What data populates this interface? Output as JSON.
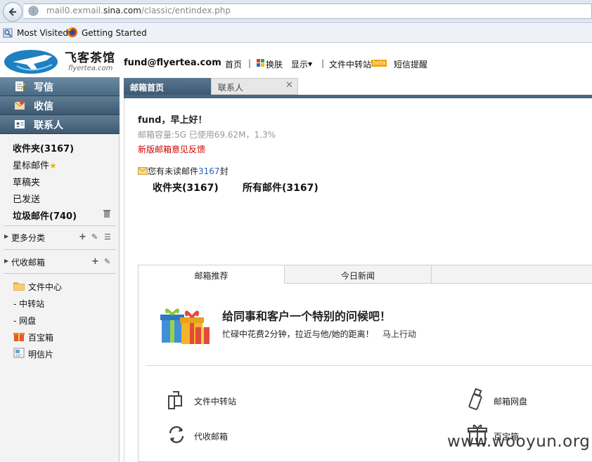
{
  "browser": {
    "url_prefix": "mail0.exmail.",
    "url_domain": "sina.com",
    "url_path": "/classic/entindex.php",
    "bookmarks": [
      "Most Visited",
      "Getting Started"
    ]
  },
  "header": {
    "logo_text": "飞客茶馆",
    "logo_sub": "flyertea.com",
    "account": "fund@flyertea.com",
    "nav": [
      "首页",
      "换肤",
      "显示",
      "文件中转站",
      "短信提醒"
    ],
    "beta_badge": "beta"
  },
  "sidebar": {
    "actions": [
      "写信",
      "收信",
      "联系人"
    ],
    "folders": [
      {
        "label": "收件夹(3167)",
        "bold": true
      },
      {
        "label": "星标邮件",
        "bold": false
      },
      {
        "label": "草稿夹",
        "bold": false
      },
      {
        "label": "已发送",
        "bold": false
      },
      {
        "label": "垃圾邮件(740)",
        "bold": true
      }
    ],
    "more_categories": "更多分类",
    "proxy_mail": "代收邮箱",
    "file_center": "文件中心",
    "transfer": "- 中转站",
    "netdisk": "- 网盘",
    "treasure": "百宝箱",
    "postcard": "明信片"
  },
  "tabs": {
    "home": "邮箱首页",
    "contacts": "联系人"
  },
  "main": {
    "greeting": "fund，早上好！",
    "quota": "邮箱容量:5G 已使用69.62M，1.3%",
    "feedback": "新版邮箱意见反馈",
    "unread_prefix": "您有未读邮件",
    "unread_count": "3167",
    "unread_suffix": "封",
    "inbox_link": "收件夹(3167)",
    "all_link": "所有邮件(3167)"
  },
  "panel": {
    "tabs": [
      "邮箱推荐",
      "今日新闻"
    ],
    "promo_title": "给同事和客户一个特别的问候吧！",
    "promo_sub": "忙碌中花费2分钟，拉近与他/她的距离！",
    "promo_action": "马上行动",
    "tools": [
      "文件中转站",
      "邮箱网盘",
      "代收邮箱",
      "百宝箱"
    ]
  },
  "watermark": "www.wooyun.org",
  "colors": {
    "sidebar_header": "#4a6780",
    "alert": "#d00000",
    "link": "#2a62b4"
  }
}
